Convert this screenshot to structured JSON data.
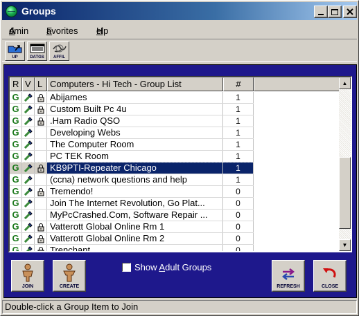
{
  "window": {
    "title": "Groups"
  },
  "menu": {
    "admin_first": "A",
    "admin_rest": "dmin",
    "fav_first": "F",
    "fav_rest": "avorites",
    "help_first": "H",
    "help_rest": "elp"
  },
  "toolbar": {
    "up_label": "UP",
    "datgs_label": "DATGS",
    "affil_label": "AFFIL"
  },
  "list": {
    "columns": {
      "r": "R",
      "v": "V",
      "l": "L",
      "name": "Computers - Hi Tech - Group List",
      "num": "#"
    },
    "rows": [
      {
        "r": "G",
        "locked": true,
        "name": "Abijames",
        "num": "1"
      },
      {
        "r": "G",
        "locked": true,
        "name": "Custom Built Pc 4u",
        "num": "1"
      },
      {
        "r": "G",
        "locked": true,
        "name": ".Ham Radio QSO",
        "num": "1"
      },
      {
        "r": "G",
        "locked": false,
        "name": "Developing Webs",
        "num": "1"
      },
      {
        "r": "G",
        "locked": false,
        "name": "The Computer Room",
        "num": "1"
      },
      {
        "r": "G",
        "locked": false,
        "name": "PC TEK Room",
        "num": "1"
      },
      {
        "r": "G",
        "locked": true,
        "name": "KB9PTI-Repeater Chicago",
        "num": "1",
        "selected": true
      },
      {
        "r": "G",
        "locked": false,
        "name": "(ccna) network questions and help",
        "num": "1"
      },
      {
        "r": "G",
        "locked": true,
        "name": "Tremendo!",
        "num": "0"
      },
      {
        "r": "G",
        "locked": false,
        "name": "Join The Internet Revolution,    Go Plat...",
        "num": "0"
      },
      {
        "r": "G",
        "locked": false,
        "name": "MyPcCrashed.Com, Software Repair ...",
        "num": "0"
      },
      {
        "r": "G",
        "locked": true,
        "name": "Vatterott Global Online Rm 1",
        "num": "0"
      },
      {
        "r": "G",
        "locked": true,
        "name": "Vatterott Global Online Rm 2",
        "num": "0"
      },
      {
        "r": "G",
        "locked": true,
        "name": "Trenchant",
        "num": "0"
      }
    ]
  },
  "buttons": {
    "join": "JOIN",
    "create": "CREATE",
    "refresh": "REFRESH",
    "close": "CLOSE"
  },
  "adult": {
    "prefix": "Show ",
    "accel": "A",
    "rest": "dult Groups",
    "checked": false
  },
  "status": {
    "text": "Double-click a Group Item to Join"
  }
}
